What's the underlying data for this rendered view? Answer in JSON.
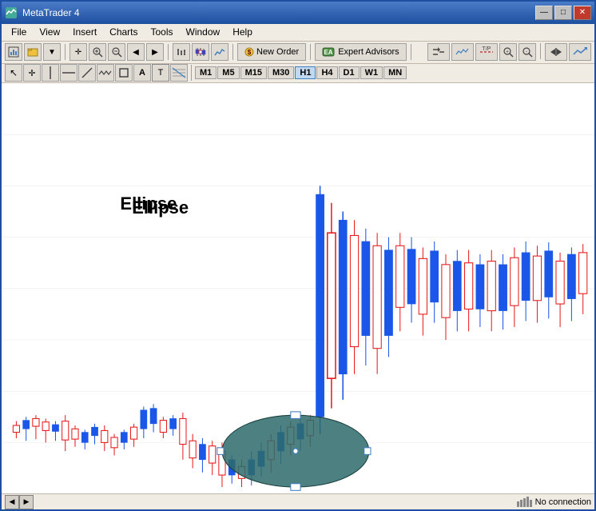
{
  "titleBar": {
    "title": "MetaTrader 4",
    "icon": "chart-icon",
    "buttons": {
      "minimize": "—",
      "maximize": "□",
      "close": "✕"
    }
  },
  "menuBar": {
    "items": [
      "File",
      "View",
      "Insert",
      "Charts",
      "Tools",
      "Window",
      "Help"
    ]
  },
  "toolbar1": {
    "newOrderLabel": "New Order",
    "expertAdvisorsLabel": "Expert Advisors"
  },
  "toolbar2": {
    "timeframes": [
      "M1",
      "M5",
      "M15",
      "M30",
      "H1",
      "H4",
      "D1",
      "W1",
      "MN"
    ]
  },
  "chart": {
    "ellipseLabel": "Ellipse",
    "backgroundColor": "#ffffff"
  },
  "statusBar": {
    "noConnection": "No connection"
  },
  "colors": {
    "bullCandle": "#1a56e8",
    "bearCandle": "#e81a1a",
    "ellipseFill": "#2e6b6b",
    "titleGradientStart": "#4a7cc7",
    "titleGradientEnd": "#1e4fa0"
  }
}
